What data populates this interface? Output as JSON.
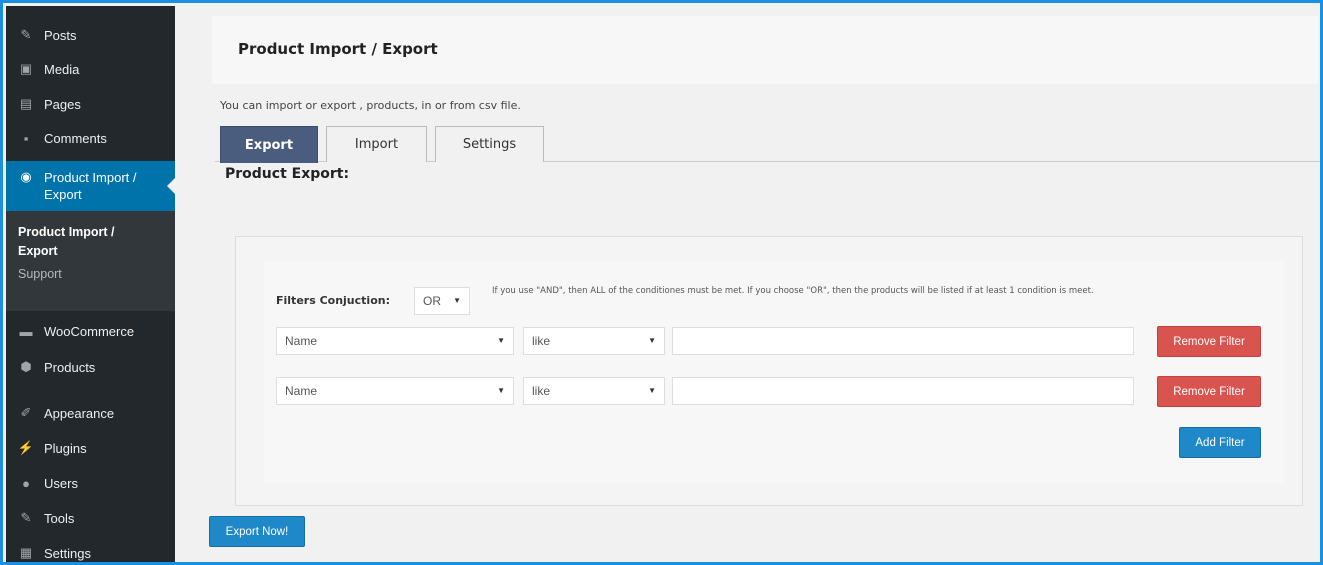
{
  "sidebar": {
    "items": [
      {
        "label": "Posts",
        "icon": "pin-icon",
        "glyph": "✎"
      },
      {
        "label": "Media",
        "icon": "media-icon",
        "glyph": "▣"
      },
      {
        "label": "Pages",
        "icon": "pages-icon",
        "glyph": "▤"
      },
      {
        "label": "Comments",
        "icon": "comments-icon",
        "glyph": "▪"
      },
      {
        "label": "Product Import / Export",
        "icon": "plugin-circle-icon",
        "glyph": "◉"
      },
      {
        "label": "WooCommerce",
        "icon": "woocommerce-icon",
        "glyph": "▬"
      },
      {
        "label": "Products",
        "icon": "products-icon",
        "glyph": "⬢"
      },
      {
        "label": "Appearance",
        "icon": "appearance-icon",
        "glyph": "✐"
      },
      {
        "label": "Plugins",
        "icon": "plugins-icon",
        "glyph": "⚡"
      },
      {
        "label": "Users",
        "icon": "users-icon",
        "glyph": "●"
      },
      {
        "label": "Tools",
        "icon": "tools-icon",
        "glyph": "✎"
      },
      {
        "label": "Settings",
        "icon": "settings-icon",
        "glyph": "▦"
      }
    ],
    "submenu": {
      "current": "Product Import / Export",
      "support": "Support"
    }
  },
  "header": {
    "title": "Product Import / Export"
  },
  "intro_text": "You can import or export , products, in or from csv file.",
  "tabs": [
    {
      "label": "Export"
    },
    {
      "label": "Import"
    },
    {
      "label": "Settings"
    }
  ],
  "section_title": "Product Export:",
  "filters": {
    "conjunction_label": "Filters Conjuction:",
    "conjunction_value": "OR",
    "hint": "If you use \"AND\", then ALL of the conditiones must be met. If you choose \"OR\", then the products will be listed if at least 1 condition is meet.",
    "rows": [
      {
        "field": "Name",
        "operator": "like",
        "value": "",
        "remove_label": "Remove Filter"
      },
      {
        "field": "Name",
        "operator": "like",
        "value": "",
        "remove_label": "Remove Filter"
      }
    ],
    "add_label": "Add Filter"
  },
  "export_button": "Export Now!",
  "colors": {
    "active_menu": "#0073aa",
    "active_tab": "#4a5d7e",
    "remove_button": "#d9534f",
    "primary_button": "#1e88c8",
    "frame_border": "#1a8fe3"
  }
}
